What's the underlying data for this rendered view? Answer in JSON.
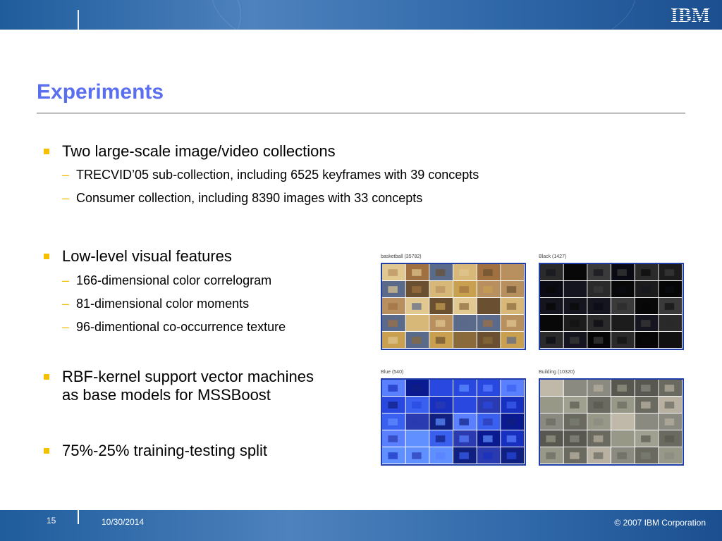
{
  "header": {
    "logo_text": "IBM"
  },
  "slide": {
    "title": "Experiments",
    "bullets": [
      {
        "text": "Two large-scale image/video collections",
        "subs": [
          "TRECVID’05 sub-collection, including 6525 keyframes with 39 concepts",
          "Consumer collection, including 8390 images with 33 concepts"
        ]
      },
      {
        "text": "Low-level visual features",
        "subs": [
          "166-dimensional color correlogram",
          "81-dimensional color moments",
          "96-dimentional co-occurrence texture"
        ]
      },
      {
        "text_line1": "RBF-kernel support vector machines",
        "text_line2": "as base models for MSSBoost"
      },
      {
        "text": "75%-25% training-testing split"
      }
    ],
    "dash": "–"
  },
  "thumbnails": [
    {
      "caption": "basketball (35782)",
      "theme": "basketball"
    },
    {
      "caption": "Black (1427)",
      "theme": "black"
    },
    {
      "caption": "Blue (540)",
      "theme": "blue"
    },
    {
      "caption": "Building (10320)",
      "theme": "building"
    }
  ],
  "footer": {
    "page_number": "15",
    "date": "10/30/2014",
    "copyright": "© 2007 IBM Corporation"
  },
  "colors": {
    "title": "#5a6ff0",
    "bullet": "#f4c000",
    "band": "#2e67a8",
    "thumb_border": "#1f3ea8"
  }
}
